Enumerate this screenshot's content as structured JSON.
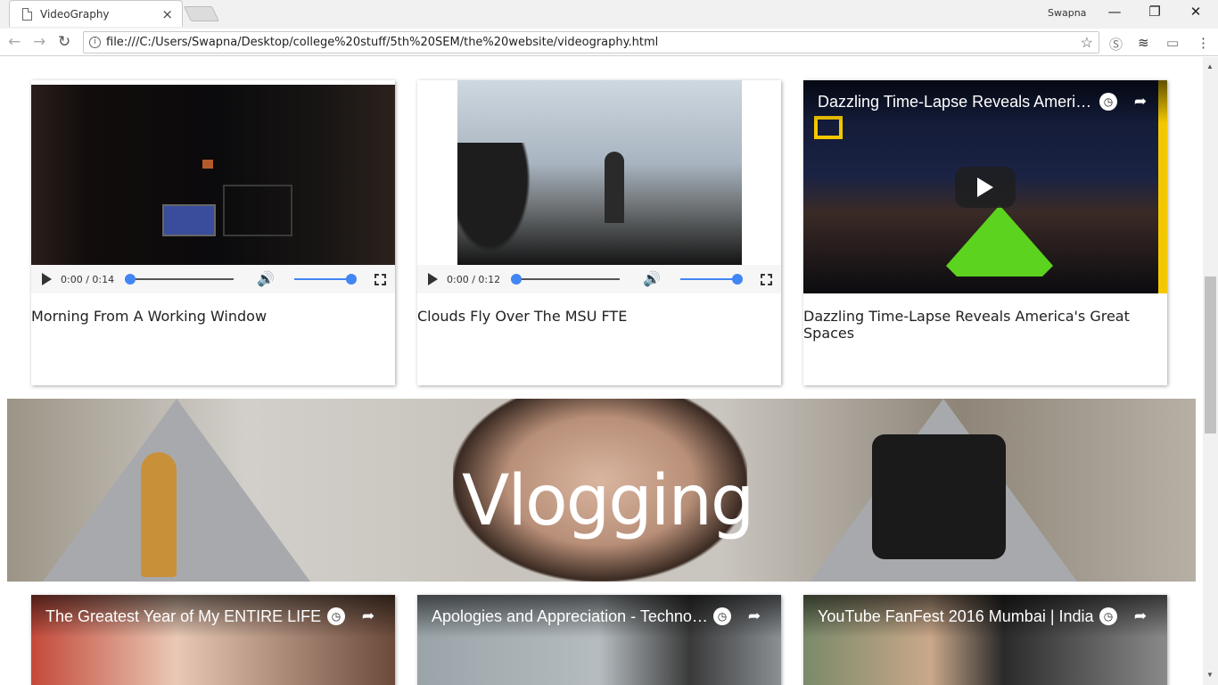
{
  "browser": {
    "tab_title": "VideoGraphy",
    "tab_close": "×",
    "user_name": "Swapna",
    "window": {
      "minimize": "—",
      "restore": "❐",
      "close": "✕"
    },
    "url": "file:///C:/Users/Swapna/Desktop/college%20stuff/5th%20SEM/the%20website/videography.html"
  },
  "videos": [
    {
      "caption": "Morning From A Working Window",
      "time": "0:00 / 0:14",
      "progress": 0,
      "volume": 1.0
    },
    {
      "caption": "Clouds Fly Over The MSU FTE",
      "time": "0:00 / 0:12",
      "progress": 0,
      "volume": 1.0
    },
    {
      "caption": "Dazzling Time-Lapse Reveals America's Great Spaces",
      "yt_title": "Dazzling Time-Lapse Reveals Americ…"
    }
  ],
  "banner": {
    "title": "Vlogging"
  },
  "vlogs": [
    {
      "yt_title": "The Greatest Year of My ENTIRE LIFE"
    },
    {
      "yt_title": "Apologies and Appreciation - Techno…"
    },
    {
      "yt_title": "YouTube FanFest 2016 Mumbai | India"
    }
  ],
  "colors": {
    "accent": "#4285f4"
  }
}
